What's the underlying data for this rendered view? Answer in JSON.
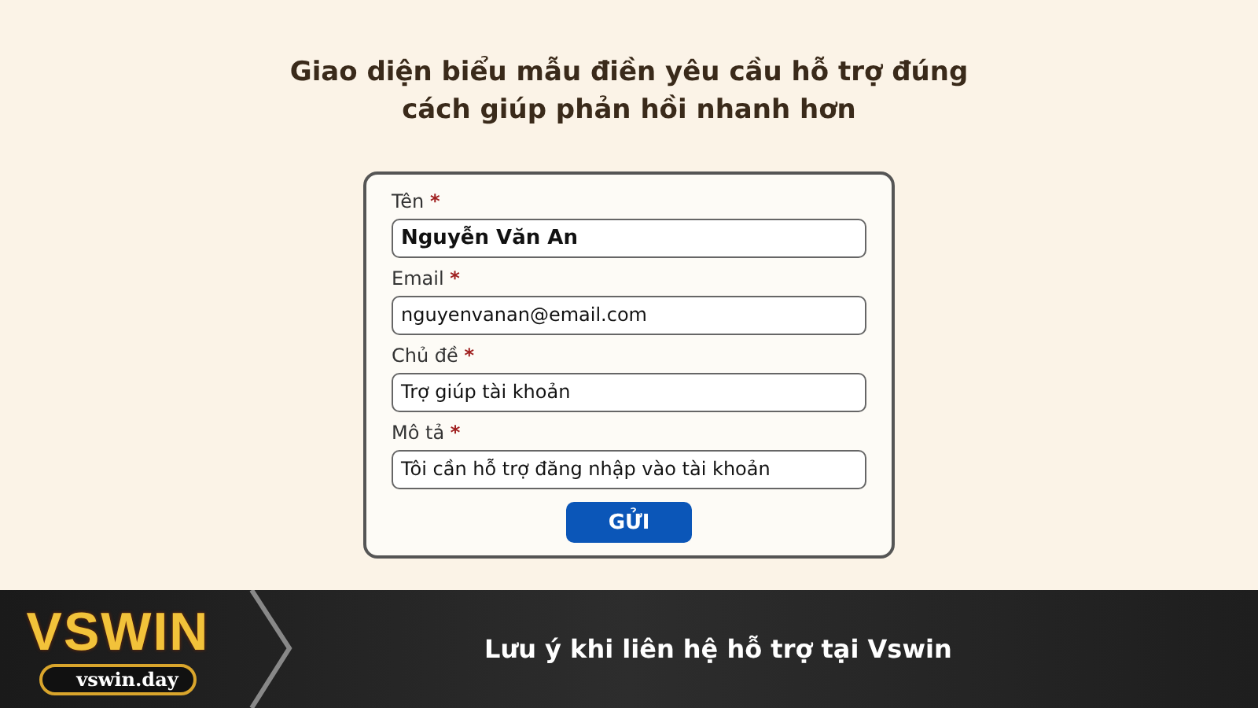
{
  "heading": "Giao diện biểu mẫu điền yêu cầu hỗ trợ đúng cách giúp phản hồi nhanh hơn",
  "form": {
    "fields": [
      {
        "label": "Tên",
        "required_mark": "*",
        "value": "Nguyễn Văn An"
      },
      {
        "label": "Email",
        "required_mark": "*",
        "value": "nguyenvanan@email.com"
      },
      {
        "label": "Chủ đề",
        "required_mark": "*",
        "value": "Trợ giúp tài khoản"
      },
      {
        "label": "Mô tả",
        "required_mark": "*",
        "value": "Tôi cần hỗ trợ đăng nhập vào tài khoản"
      }
    ],
    "submit_button": "GỬI"
  },
  "banner": {
    "logo": "VSWIN",
    "domain": "vswin.day",
    "title": "Lưu ý khi liên hệ hỗ trợ tại Vswin"
  }
}
